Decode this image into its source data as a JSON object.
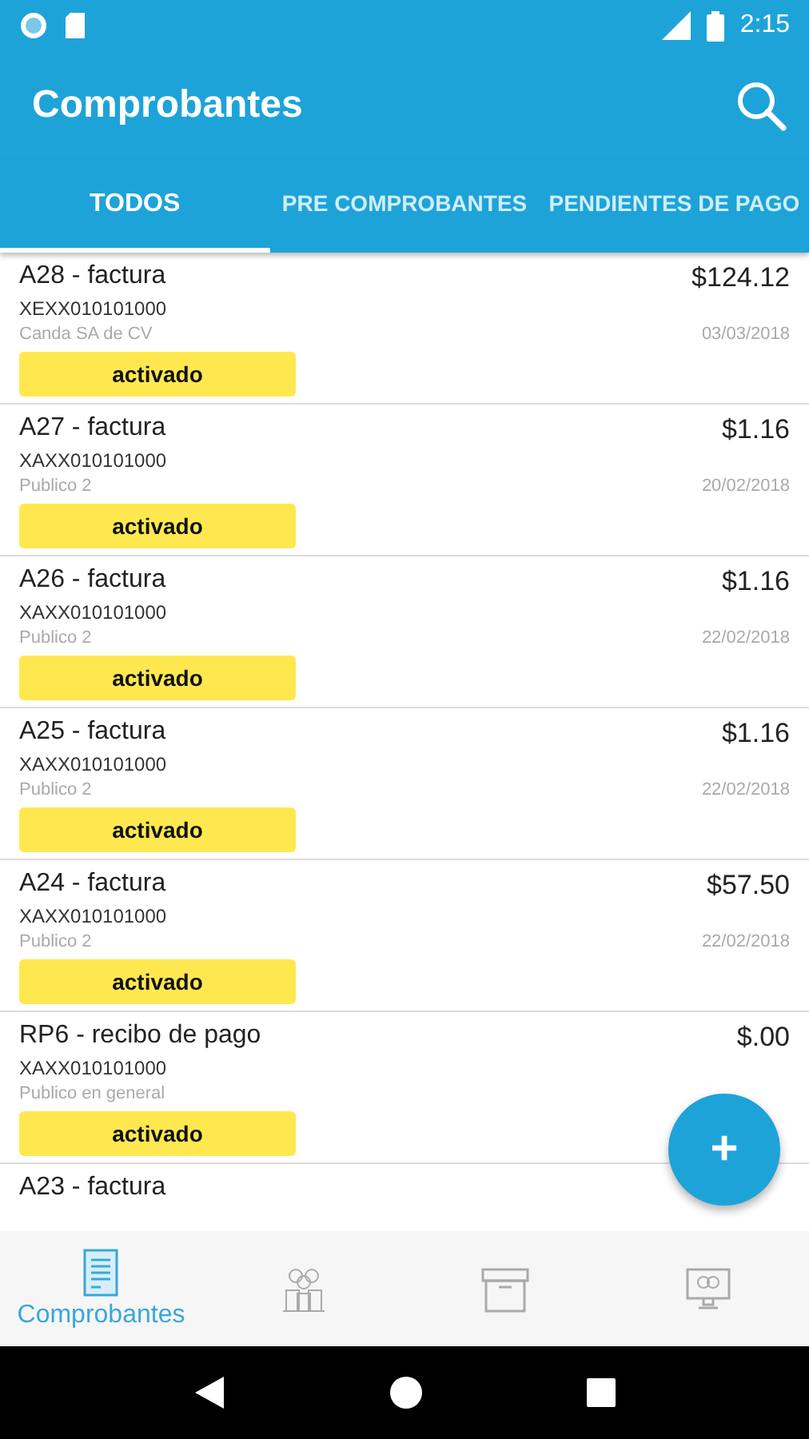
{
  "status_bar": {
    "time": "2:15"
  },
  "app_bar": {
    "title": "Comprobantes"
  },
  "tabs": [
    {
      "label": "TODOS",
      "selected": true
    },
    {
      "label": "PRE COMPROBANTES",
      "selected": false
    },
    {
      "label": "PENDIENTES DE PAGO",
      "selected": false
    }
  ],
  "items": [
    {
      "title": "A28 - factura",
      "amount": "$124.12",
      "rfc": "XEXX010101000",
      "client": "Canda SA de CV",
      "date": "03/03/2018",
      "status": "activado"
    },
    {
      "title": "A27 - factura",
      "amount": "$1.16",
      "rfc": "XAXX010101000",
      "client": "Publico 2",
      "date": "20/02/2018",
      "status": "activado"
    },
    {
      "title": "A26 - factura",
      "amount": "$1.16",
      "rfc": "XAXX010101000",
      "client": "Publico 2",
      "date": "22/02/2018",
      "status": "activado"
    },
    {
      "title": "A25 - factura",
      "amount": "$1.16",
      "rfc": "XAXX010101000",
      "client": "Publico 2",
      "date": "22/02/2018",
      "status": "activado"
    },
    {
      "title": "A24 - factura",
      "amount": "$57.50",
      "rfc": "XAXX010101000",
      "client": "Publico 2",
      "date": "22/02/2018",
      "status": "activado"
    },
    {
      "title": "RP6 - recibo de pago",
      "amount": "$.00",
      "rfc": "XAXX010101000",
      "client": "Publico en general",
      "status": "activado"
    },
    {
      "title": "A23 - factura"
    }
  ],
  "fab": {
    "label": "+"
  },
  "bottom_nav": [
    {
      "kind": "document",
      "label": "Comprobantes",
      "selected": true
    },
    {
      "kind": "people",
      "selected": false
    },
    {
      "kind": "box",
      "selected": false
    },
    {
      "kind": "monitor",
      "selected": false
    }
  ]
}
